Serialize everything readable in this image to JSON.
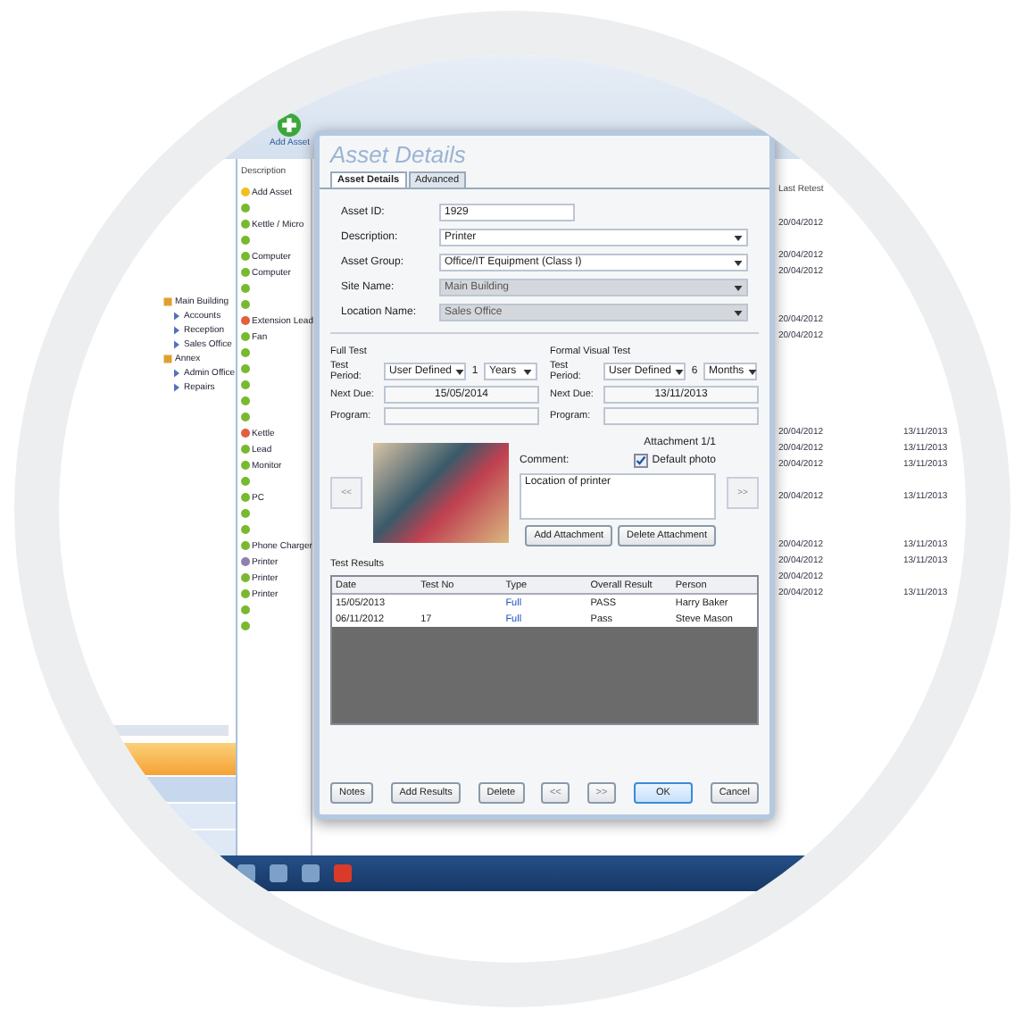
{
  "toolbar": {
    "add_button": "Add Asset"
  },
  "tree": {
    "items": [
      {
        "label": "Main Building",
        "children": [
          {
            "label": "Accounts"
          },
          {
            "label": "Reception"
          },
          {
            "label": "Sales Office"
          }
        ]
      },
      {
        "label": "Annex",
        "children": [
          {
            "label": "Admin Office"
          },
          {
            "label": "Repairs"
          }
        ]
      }
    ]
  },
  "asset_list": {
    "header": "Description",
    "items": [
      {
        "label": "Add Asset",
        "color": "#f0c020"
      },
      {
        "color": "#7ab830"
      },
      {
        "label": "Kettle / Micro",
        "color": "#7ab830"
      },
      {
        "color": "#7ab830"
      },
      {
        "label": "Computer",
        "color": "#7ab830"
      },
      {
        "label": "Computer",
        "color": "#7ab830"
      },
      {
        "color": "#7ab830"
      },
      {
        "color": "#7ab830"
      },
      {
        "label": "Extension Lead",
        "color": "#e06040"
      },
      {
        "label": "Fan",
        "color": "#7ab830"
      },
      {
        "color": "#7ab830"
      },
      {
        "color": "#7ab830"
      },
      {
        "color": "#7ab830"
      },
      {
        "color": "#7ab830"
      },
      {
        "color": "#7ab830"
      },
      {
        "label": "Kettle",
        "color": "#e06040"
      },
      {
        "label": "Lead",
        "color": "#7ab830"
      },
      {
        "label": "Monitor",
        "color": "#7ab830"
      },
      {
        "color": "#7ab830"
      },
      {
        "label": "PC",
        "color": "#7ab830"
      },
      {
        "color": "#7ab830"
      },
      {
        "color": "#7ab830"
      },
      {
        "label": "Phone Charger",
        "color": "#7ab830"
      },
      {
        "label": "Printer",
        "color": "#9080b0"
      },
      {
        "label": "Printer",
        "color": "#7ab830"
      },
      {
        "label": "Printer",
        "color": "#7ab830"
      },
      {
        "color": "#7ab830"
      },
      {
        "color": "#7ab830"
      }
    ]
  },
  "date_columns": {
    "header": "Last Retest",
    "rows": [
      [
        "",
        ""
      ],
      [
        "20/04/2012",
        ""
      ],
      [
        "",
        ""
      ],
      [
        "20/04/2012",
        ""
      ],
      [
        "20/04/2012",
        ""
      ],
      [
        "",
        ""
      ],
      [
        "",
        ""
      ],
      [
        "20/04/2012",
        ""
      ],
      [
        "20/04/2012",
        ""
      ],
      [
        "",
        ""
      ],
      [
        "",
        ""
      ],
      [
        "",
        ""
      ],
      [
        "",
        ""
      ],
      [
        "",
        ""
      ],
      [
        "20/04/2012",
        "13/11/2013"
      ],
      [
        "20/04/2012",
        "13/11/2013"
      ],
      [
        "20/04/2012",
        "13/11/2013"
      ],
      [
        "",
        ""
      ],
      [
        "20/04/2012",
        "13/11/2013"
      ],
      [
        "",
        ""
      ],
      [
        "",
        ""
      ],
      [
        "20/04/2012",
        "13/11/2013"
      ],
      [
        "20/04/2012",
        "13/11/2013"
      ],
      [
        "20/04/2012",
        ""
      ],
      [
        "20/04/2012",
        "13/11/2013"
      ]
    ]
  },
  "dialog": {
    "title": "Asset Details",
    "tabs": [
      {
        "label": "Asset Details",
        "selected": true
      },
      {
        "label": "Advanced",
        "selected": false
      }
    ],
    "fields": [
      {
        "label": "Asset ID:",
        "value": "1929",
        "kind": "text",
        "disabled": false
      },
      {
        "label": "Description:",
        "value": "Printer",
        "kind": "select",
        "disabled": false
      },
      {
        "label": "Asset Group:",
        "value": "Office/IT Equipment (Class I)",
        "kind": "select",
        "disabled": false
      },
      {
        "label": "Site Name:",
        "value": "Main Building",
        "kind": "select",
        "disabled": true
      },
      {
        "label": "Location Name:",
        "value": "Sales Office",
        "kind": "select",
        "disabled": true
      }
    ],
    "tests": [
      {
        "title": "Full Test",
        "period_label": "Test Period:",
        "period": "User Defined",
        "number": "1",
        "unit": "Years",
        "due_label": "Next Due:",
        "due": "15/05/2014",
        "program_label": "Program:"
      },
      {
        "title": "Formal Visual Test",
        "period_label": "Test Period:",
        "period": "User Defined",
        "number": "6",
        "unit": "Months",
        "due_label": "Next Due:",
        "due": "13/11/2013",
        "program_label": "Program:"
      }
    ],
    "attachment": {
      "counter": "Attachment 1/1",
      "comment_label": "Comment:",
      "default_photo": {
        "label": "Default photo",
        "checked": true
      },
      "comment": "Location of printer",
      "prev": "<<",
      "next": ">>",
      "buttons": [
        "Add Attachment",
        "Delete Attachment"
      ]
    },
    "results": {
      "title": "Test Results",
      "columns": [
        "Date",
        "Test No",
        "Type",
        "Overall Result",
        "Person"
      ],
      "rows": [
        [
          "15/05/2013",
          "",
          "Full",
          "PASS",
          "Harry Baker"
        ],
        [
          "06/11/2012",
          "17",
          "Full",
          "Pass",
          "Steve Mason"
        ]
      ]
    },
    "buttons": [
      {
        "label": "Notes",
        "kind": "normal"
      },
      {
        "label": "Add Results",
        "kind": "normal"
      },
      {
        "label": "Delete",
        "kind": "normal"
      },
      {
        "label": "<<",
        "kind": "nav"
      },
      {
        "label": ">>",
        "kind": "nav"
      },
      {
        "label": "OK",
        "kind": "default"
      },
      {
        "label": "Cancel",
        "kind": "normal"
      }
    ]
  }
}
